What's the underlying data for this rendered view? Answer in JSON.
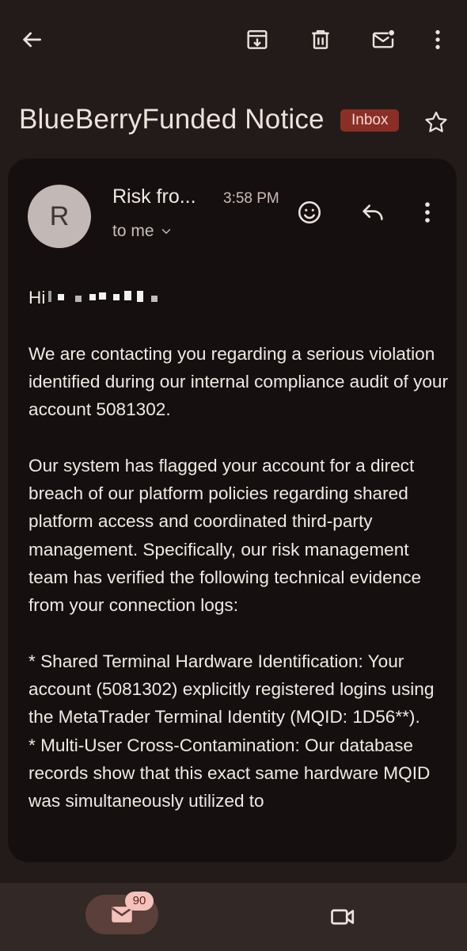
{
  "toolbar": {
    "back_icon": "arrow-back-icon",
    "archive_icon": "archive-icon",
    "delete_icon": "trash-icon",
    "unread_icon": "mark-unread-icon",
    "more_icon": "more-vert-icon"
  },
  "email": {
    "subject": "BlueBerryFunded Notice",
    "label": "Inbox",
    "sender_initial": "R",
    "sender": "Risk fro...",
    "time": "3:58 PM",
    "recipient": "to me",
    "greeting": "Hi",
    "paragraphs": [
      "We are contacting you regarding a serious violation identified during our internal compliance audit of your account 5081302.",
      "Our system has flagged your account for a direct breach of our platform policies regarding shared platform access and coordinated third-party management. Specifically, our risk management team has verified the following technical evidence from your connection logs:"
    ],
    "bullets": [
      "* Shared Terminal Hardware Identification: Your account (5081302) explicitly registered logins using the MetaTrader Terminal Identity (MQID: 1D56**).",
      "* Multi-User Cross-Contamination: Our database records show that this exact same hardware MQID was simultaneously utilized to"
    ]
  },
  "bottom_nav": {
    "mail_badge": "90",
    "mail_icon": "mail-icon",
    "meet_icon": "video-camera-icon"
  },
  "colors": {
    "background": "#231b19",
    "card": "#15100f",
    "inbox_badge": "#8a2f26",
    "bottom_bar": "#322826"
  }
}
